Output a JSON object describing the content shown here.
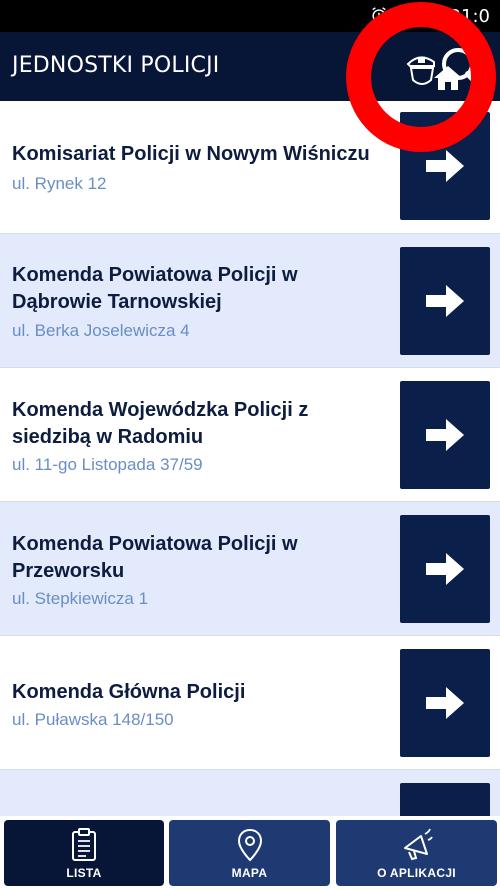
{
  "status_bar": {
    "time": "21:0"
  },
  "header": {
    "title": "JEDNOSTKI POLICJI",
    "action_icon": "police-station-search-icon"
  },
  "units": [
    {
      "title": "Komisariat Policji w Nowym Wiśniczu",
      "address": "ul. Rynek 12"
    },
    {
      "title": "Komenda Powiatowa Policji w Dąbrowie Tarnowskiej",
      "address": "ul. Berka Joselewicza 4"
    },
    {
      "title": "Komenda Wojewódzka Policji z siedzibą w Radomiu",
      "address": "ul. 11-go Listopada 37/59"
    },
    {
      "title": "Komenda Powiatowa Policji w Przeworsku",
      "address": "ul. Stepkiewicza 1"
    },
    {
      "title": "Komenda Główna Policji",
      "address": "ul. Puławska 148/150"
    }
  ],
  "bottom_nav": {
    "lista": "LISTA",
    "mapa": "MAPA",
    "o_aplikacji": "O APLIKACJI"
  },
  "colors": {
    "header_bg": "#071536",
    "alt_row_bg": "#e2eafb",
    "arrow_button_bg": "#0b1f4b",
    "title_text": "#0e1d3f",
    "address_text": "#6a8ec4",
    "highlight_ring": "#ff0000"
  }
}
